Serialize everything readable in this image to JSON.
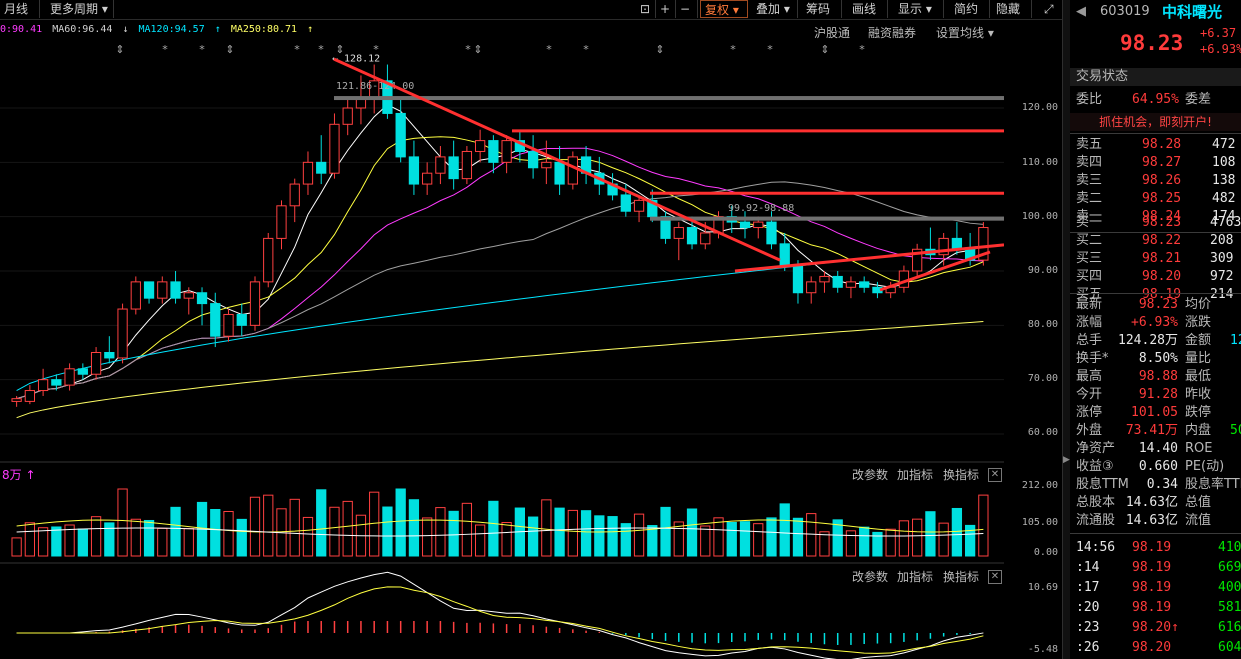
{
  "toolbar": {
    "period": "月线",
    "more_period": "更多周期",
    "tools": [
      "复权",
      "叠加",
      "筹码",
      "画线",
      "显示",
      "简约",
      "隐藏"
    ]
  },
  "ma_legend": [
    {
      "label": "0:90.41",
      "color": "#ff3bff"
    },
    {
      "label": "MA60:96.44",
      "color": "#d0d0d0"
    },
    {
      "label": "MA120:94.57",
      "color": "#00e5ff"
    },
    {
      "label": "MA250:80.71",
      "color": "#ffff66"
    }
  ],
  "links": [
    "沪股通",
    "融资融券",
    "设置均线"
  ],
  "price_axis": [
    "120.00",
    "110.00",
    "100.00",
    "90.00",
    "80.00",
    "70.00",
    "60.00"
  ],
  "vol_axis": [
    "212.00",
    "105.00",
    "0.00"
  ],
  "macd_axis": [
    "10.69",
    "-5.48"
  ],
  "vol_label": "8万",
  "panel_buttons": [
    "改参数",
    "加指标",
    "换指标"
  ],
  "annotations": {
    "high": "128.12",
    "band1": "121.86-124.00",
    "band2": "99.92-98.88"
  },
  "chart_data": {
    "type": "candlestick",
    "ylim": [
      58,
      130
    ],
    "candles": [
      [
        66,
        67,
        65,
        66.5
      ],
      [
        66,
        69,
        65.5,
        68
      ],
      [
        68,
        72,
        67,
        70
      ],
      [
        70,
        71,
        68,
        69
      ],
      [
        69,
        73,
        68,
        72
      ],
      [
        72,
        73,
        70,
        71
      ],
      [
        71,
        76,
        70,
        75
      ],
      [
        75,
        78,
        73,
        74
      ],
      [
        74,
        84,
        73,
        83
      ],
      [
        83,
        89,
        82,
        88
      ],
      [
        88,
        88,
        84,
        85
      ],
      [
        85,
        89,
        84,
        88
      ],
      [
        88,
        90,
        84,
        85
      ],
      [
        85,
        87,
        82,
        86
      ],
      [
        86,
        87,
        80,
        84
      ],
      [
        84,
        86,
        76,
        78
      ],
      [
        78,
        83,
        77,
        82
      ],
      [
        82,
        84,
        78,
        80
      ],
      [
        80,
        89,
        79,
        88
      ],
      [
        88,
        97,
        87,
        96
      ],
      [
        96,
        103,
        94,
        102
      ],
      [
        102,
        107,
        99,
        106
      ],
      [
        106,
        112,
        104,
        110
      ],
      [
        110,
        115,
        106,
        108
      ],
      [
        108,
        119,
        107,
        117
      ],
      [
        117,
        122,
        115,
        120
      ],
      [
        120,
        126,
        117,
        122
      ],
      [
        122,
        128,
        119,
        125
      ],
      [
        125,
        128,
        118,
        119
      ],
      [
        119,
        122,
        110,
        111
      ],
      [
        111,
        114,
        104,
        106
      ],
      [
        106,
        110,
        104,
        108
      ],
      [
        108,
        113,
        106,
        111
      ],
      [
        111,
        114,
        105,
        107
      ],
      [
        107,
        113,
        106,
        112
      ],
      [
        112,
        116,
        110,
        114
      ],
      [
        114,
        115,
        108,
        110
      ],
      [
        110,
        115,
        108,
        114
      ],
      [
        114,
        116,
        110,
        112
      ],
      [
        112,
        115,
        107,
        109
      ],
      [
        109,
        114,
        106,
        110
      ],
      [
        110,
        113,
        104,
        106
      ],
      [
        106,
        112,
        105,
        111
      ],
      [
        111,
        113,
        106,
        108
      ],
      [
        108,
        111,
        104,
        106
      ],
      [
        106,
        108,
        103,
        104
      ],
      [
        104,
        106,
        100,
        101
      ],
      [
        101,
        104,
        99,
        103
      ],
      [
        103,
        105,
        99,
        100
      ],
      [
        100,
        101,
        95,
        96
      ],
      [
        96,
        99,
        92,
        98
      ],
      [
        98,
        100,
        94,
        95
      ],
      [
        95,
        99,
        94,
        97
      ],
      [
        97,
        101,
        96,
        100
      ],
      [
        100,
        102,
        97,
        99
      ],
      [
        99,
        101,
        96,
        98
      ],
      [
        98,
        100,
        96,
        99
      ],
      [
        99,
        101,
        94,
        95
      ],
      [
        95,
        97,
        90,
        91
      ],
      [
        91,
        92,
        84,
        86
      ],
      [
        86,
        89,
        84,
        88
      ],
      [
        88,
        90,
        86,
        89
      ],
      [
        89,
        90,
        86,
        87
      ],
      [
        87,
        89,
        85,
        88
      ],
      [
        88,
        89,
        86,
        87
      ],
      [
        87,
        88,
        85,
        86
      ],
      [
        86,
        88,
        85,
        87
      ],
      [
        87,
        91,
        86,
        90
      ],
      [
        90,
        95,
        89,
        94
      ],
      [
        94,
        98,
        92,
        93
      ],
      [
        93,
        97,
        91,
        96
      ],
      [
        96,
        99,
        93,
        94
      ],
      [
        94,
        97,
        91,
        92
      ],
      [
        92,
        99,
        91,
        98
      ]
    ],
    "ma_levels": {
      "MA250": 80.71,
      "MA120": 94.57,
      "MA60": 96.44
    }
  },
  "quote": {
    "code": "603019",
    "name": "中科曙光",
    "price": "98.23",
    "change": "+6.37",
    "change_pct": "+6.93%",
    "trade_status": "交易状态",
    "weibi_label": "委比",
    "weibi": "64.95%",
    "weicha_label": "委差",
    "promo": "抓住机会，即刻开户!",
    "asks": [
      {
        "label": "卖五",
        "price": "98.28",
        "vol": "472"
      },
      {
        "label": "卖四",
        "price": "98.27",
        "vol": "108"
      },
      {
        "label": "卖三",
        "price": "98.26",
        "vol": "138"
      },
      {
        "label": "卖二",
        "price": "98.25",
        "vol": "482"
      },
      {
        "label": "卖一",
        "price": "98.24",
        "vol": "174"
      }
    ],
    "bids": [
      {
        "label": "买一",
        "price": "98.23",
        "vol": "4763"
      },
      {
        "label": "买二",
        "price": "98.22",
        "vol": "208"
      },
      {
        "label": "买三",
        "price": "98.21",
        "vol": "309"
      },
      {
        "label": "买四",
        "price": "98.20",
        "vol": "972"
      },
      {
        "label": "买五",
        "price": "98.19",
        "vol": "214"
      }
    ],
    "stats": [
      {
        "k": "最新",
        "v": "98.23",
        "c": "red",
        "k2": "均价"
      },
      {
        "k": "涨幅",
        "v": "+6.93%",
        "c": "red",
        "k2": "涨跌"
      },
      {
        "k": "总手",
        "v": "124.28万",
        "c": "white",
        "k2": "金额"
      },
      {
        "k": "换手*",
        "v": "8.50%",
        "c": "white",
        "k2": "量比"
      },
      {
        "k": "最高",
        "v": "98.88",
        "c": "red",
        "k2": "最低"
      },
      {
        "k": "今开",
        "v": "91.28",
        "c": "red",
        "k2": "昨收"
      },
      {
        "k": "涨停",
        "v": "101.05",
        "c": "red",
        "k2": "跌停"
      },
      {
        "k": "外盘",
        "v": "73.41万",
        "c": "red",
        "k2": "内盘"
      },
      {
        "k": "净资产",
        "v": "14.40",
        "c": "white",
        "k2": "ROE"
      },
      {
        "k": "收益③",
        "v": "0.660",
        "c": "white",
        "k2": "PE(动)"
      },
      {
        "k": "股息TTM",
        "v": "0.34",
        "c": "white",
        "k2": "股息率TTM"
      },
      {
        "k": "总股本",
        "v": "14.63亿",
        "c": "white",
        "k2": "总值"
      },
      {
        "k": "流通股",
        "v": "14.63亿",
        "c": "white",
        "k2": "流值"
      }
    ],
    "stat_extra": {
      "amount": "12",
      "inner": "50"
    },
    "ticks": [
      {
        "t": "14:56",
        "p": "98.19",
        "v": "410"
      },
      {
        "t": ":14",
        "p": "98.19",
        "v": "669"
      },
      {
        "t": ":17",
        "p": "98.19",
        "v": "400"
      },
      {
        "t": ":20",
        "p": "98.19",
        "v": "581"
      },
      {
        "t": ":23",
        "p": "98.20↑",
        "v": "616"
      },
      {
        "t": ":26",
        "p": "98.20",
        "v": "604"
      }
    ]
  }
}
